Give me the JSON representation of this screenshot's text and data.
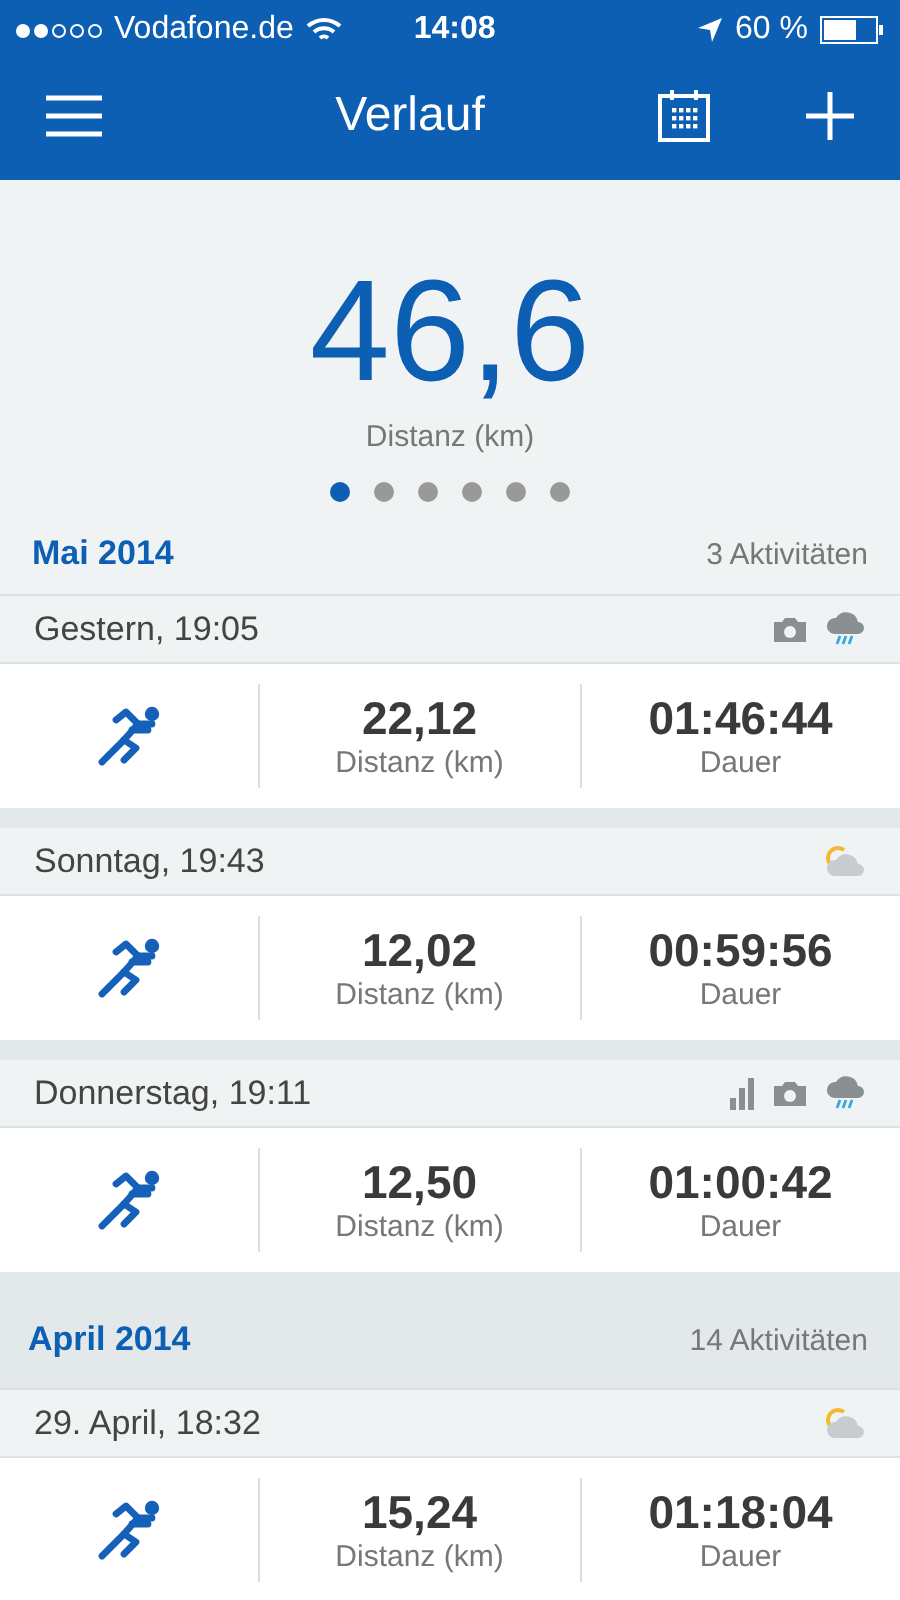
{
  "status_bar": {
    "carrier": "Vodafone.de",
    "time": "14:08",
    "battery": "60 %"
  },
  "nav_bar": {
    "title": "Verlauf"
  },
  "summary": {
    "value": "46,6",
    "label": "Distanz (km)",
    "pages": [
      {
        "selected": true
      },
      {
        "selected": false
      },
      {
        "selected": false
      },
      {
        "selected": false
      },
      {
        "selected": false
      },
      {
        "selected": false
      }
    ]
  },
  "months": [
    {
      "title": "Mai 2014",
      "count": "3 Aktivitäten",
      "activities": [
        {
          "date": "Gestern, 19:05",
          "icons": [
            {
              "kind": "camera"
            },
            {
              "kind": "rain"
            }
          ],
          "distance": "22,12",
          "distance_label": "Distanz (km)",
          "duration": "01:46:44",
          "duration_label": "Dauer"
        },
        {
          "date": "Sonntag, 19:43",
          "icons": [
            {
              "kind": "sun-cloud"
            }
          ],
          "distance": "12,02",
          "distance_label": "Distanz (km)",
          "duration": "00:59:56",
          "duration_label": "Dauer"
        },
        {
          "date": "Donnerstag, 19:11",
          "icons": [
            {
              "kind": "chart"
            },
            {
              "kind": "camera"
            },
            {
              "kind": "rain"
            }
          ],
          "distance": "12,50",
          "distance_label": "Distanz (km)",
          "duration": "01:00:42",
          "duration_label": "Dauer"
        }
      ]
    },
    {
      "title": "April 2014",
      "count": "14 Aktivitäten",
      "activities": [
        {
          "date": "29. April, 18:32",
          "icons": [
            {
              "kind": "sun-cloud"
            }
          ],
          "distance": "15,24",
          "distance_label": "Distanz (km)",
          "duration": "01:18:04",
          "duration_label": "Dauer"
        }
      ]
    }
  ]
}
